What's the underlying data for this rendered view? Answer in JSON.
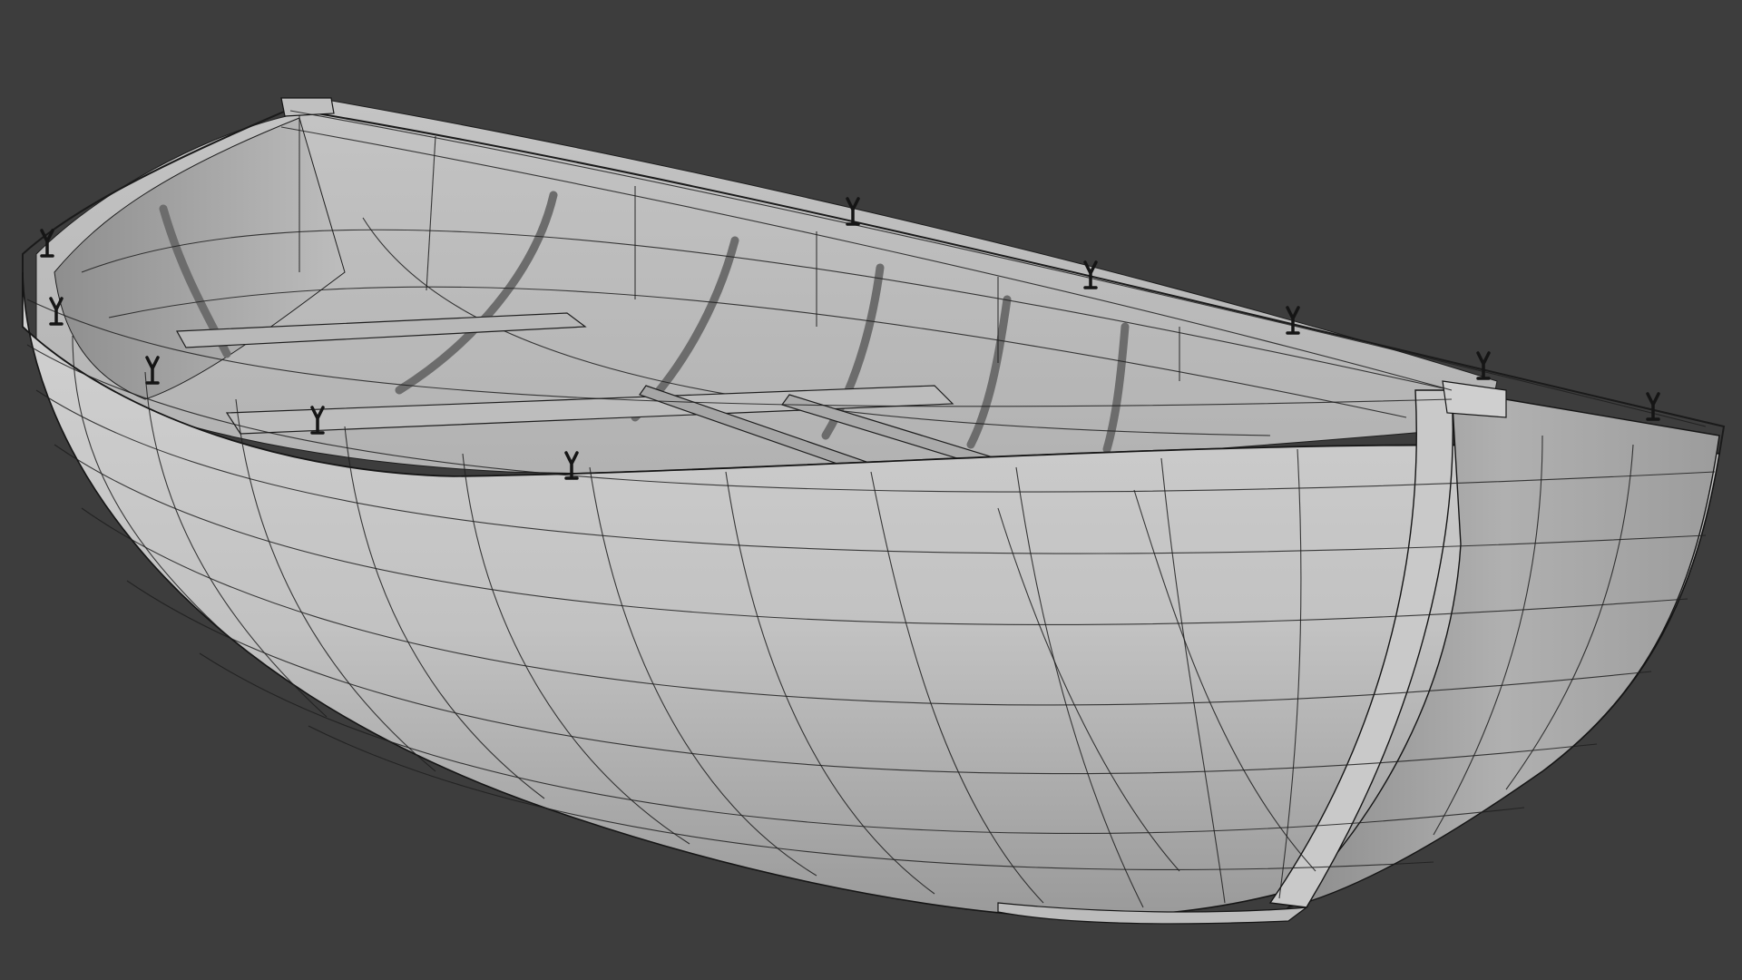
{
  "scene": {
    "background_color": "#3d3d3d",
    "object": "rowboat",
    "shading": "solid-with-wireframe",
    "oarlock_count": 10,
    "oar_count": 2,
    "thwart_count": 3,
    "colors": {
      "hull_light": "#cfcfcf",
      "hull_mid": "#aaaaaa",
      "hull_dark": "#7a7a7a",
      "wire": "#1e1e1e",
      "oarlock": "#151515"
    }
  }
}
